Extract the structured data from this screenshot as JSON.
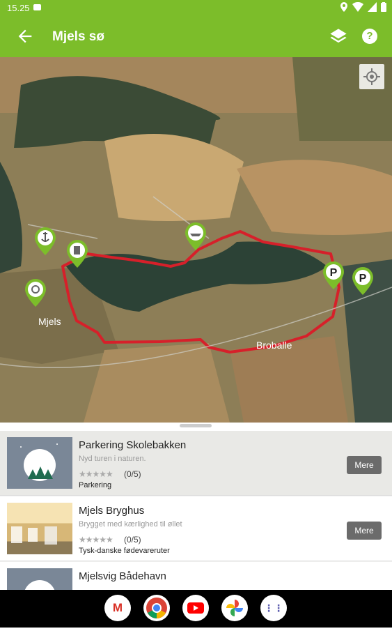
{
  "status": {
    "time": "15.25"
  },
  "appbar": {
    "title": "Mjels sø",
    "help_label": "?"
  },
  "map": {
    "place_labels": [
      "Mjels",
      "Broballe"
    ],
    "parking_pin_label": "P"
  },
  "items": [
    {
      "name": "Parkering Skolebakken",
      "subtitle": "Nyd turen i naturen.",
      "stars": "★★★★★",
      "rating": "(0/5)",
      "category": "Parkering",
      "more": "Mere"
    },
    {
      "name": "Mjels Bryghus",
      "subtitle": "Brygget med kærlighed til øllet",
      "stars": "★★★★★",
      "rating": "(0/5)",
      "category": "Tysk-danske fødevareruter",
      "more": "Mere"
    },
    {
      "name": "Mjelsvig Bådehavn",
      "subtitle": "",
      "stars": "",
      "rating": "",
      "category": "",
      "more": ""
    }
  ],
  "navbar": {
    "gmail_letter": "M",
    "launcher_dots": "⋮⋮"
  }
}
